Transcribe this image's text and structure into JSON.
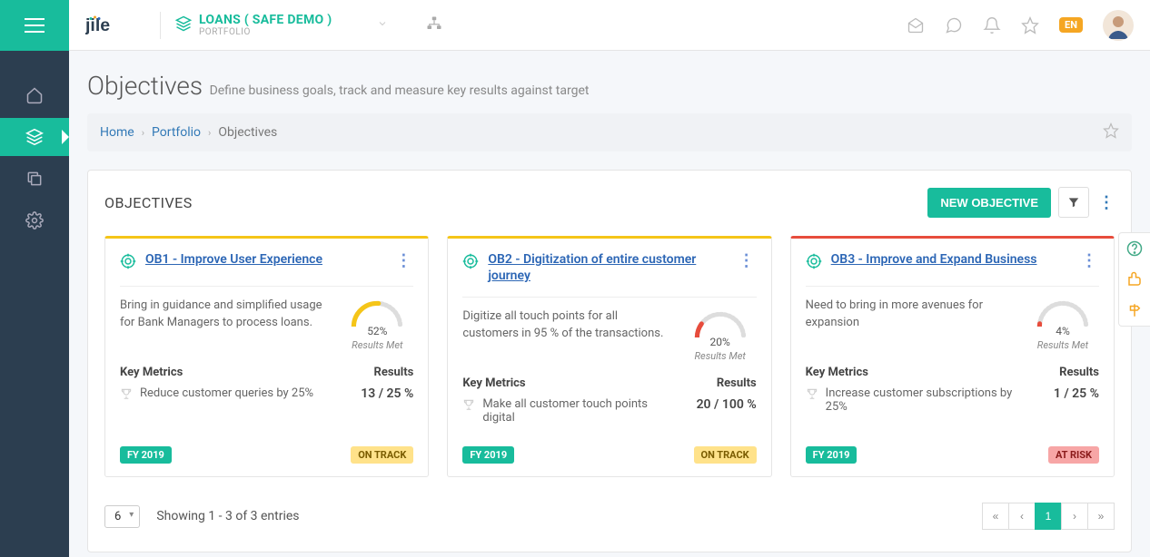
{
  "header": {
    "portfolio_title": "LOANS ( SAFE DEMO )",
    "portfolio_sub": "PORTFOLIO",
    "lang": "EN"
  },
  "page": {
    "title": "Objectives",
    "subtitle": "Define business goals, track and measure key results against target"
  },
  "breadcrumb": {
    "home": "Home",
    "portfolio": "Portfolio",
    "current": "Objectives"
  },
  "panel": {
    "title": "OBJECTIVES",
    "new_button": "NEW OBJECTIVE"
  },
  "gauge_label": "Results Met",
  "metrics_label": "Key Metrics",
  "results_label": "Results",
  "objectives": [
    {
      "title": "OB1 - Improve User Experience",
      "desc": "Bring in guidance and simplified usage for Bank Managers to process loans.",
      "pct": "52%",
      "metric": "Reduce customer queries by 25%",
      "result": "13 / 25 %",
      "fy": "FY 2019",
      "status": "ON TRACK",
      "status_class": "status-ontrack",
      "top_class": "warn-top",
      "gauge_color": "#f5c518"
    },
    {
      "title": "OB2 - Digitization of entire customer journey",
      "desc": "Digitize all touch points for all customers in 95 % of the transactions.",
      "pct": "20%",
      "metric": "Make all customer touch points digital",
      "result": "20 / 100 %",
      "fy": "FY 2019",
      "status": "ON TRACK",
      "status_class": "status-ontrack",
      "top_class": "warn-top",
      "gauge_color": "#e74c3c"
    },
    {
      "title": "OB3 - Improve and Expand Business",
      "desc": "Need to bring in more avenues for expansion",
      "pct": "4%",
      "metric": "Increase customer subscriptions by 25%",
      "result": "1 / 25 %",
      "fy": "FY 2019",
      "status": "AT RISK",
      "status_class": "status-atrisk",
      "top_class": "risk-top",
      "gauge_color": "#e74c3c"
    }
  ],
  "footer": {
    "page_size": "6",
    "showing": "Showing 1 - 3 of 3 entries",
    "current_page": "1"
  }
}
